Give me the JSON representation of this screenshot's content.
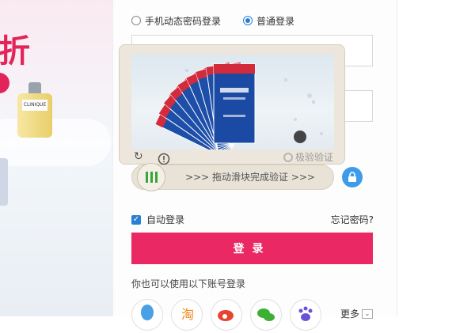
{
  "banner": {
    "promo_text": "折",
    "product_label": "CLINIQUE"
  },
  "login_mode": {
    "options": [
      {
        "label": "手机动态密码登录",
        "selected": false
      },
      {
        "label": "普通登录",
        "selected": true
      }
    ]
  },
  "captcha": {
    "refresh_icon": "refresh-icon",
    "info_icon": "info-icon",
    "brand": "极验验证",
    "product_panel": "pack-panel"
  },
  "slider": {
    "hint": ">>> 拖动滑块完成验证 >>>",
    "knob_icon": "grip-icon",
    "progress": 0
  },
  "lock": {
    "icon": "lock-icon"
  },
  "options": {
    "remember": "自动登录",
    "remember_checked": true,
    "forgot": "忘记密码?"
  },
  "login_button": "登录",
  "alt_login": {
    "text": "你也可以使用以下账号登录",
    "providers": [
      "qq-icon",
      "taobao-icon",
      "weibo-icon",
      "wechat-icon",
      "baidu-icon"
    ],
    "more": "更多"
  },
  "colors": {
    "primary": "#ea2863",
    "accent": "#2a7fd4",
    "lock": "#3d9be9",
    "slider_grip": "#3aa33a"
  }
}
